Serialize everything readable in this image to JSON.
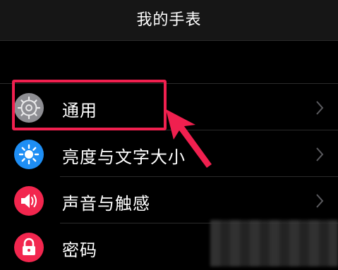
{
  "navbar": {
    "title": "我的手表"
  },
  "settings": [
    {
      "label": "通用",
      "icon": "gear-icon",
      "icon_color": "#8e8e93",
      "has_chevron": true
    },
    {
      "label": "亮度与文字大小",
      "icon": "brightness-icon",
      "icon_color": "#1e8ef4",
      "has_chevron": true
    },
    {
      "label": "声音与触感",
      "icon": "speaker-icon",
      "icon_color": "#f2264e",
      "has_chevron": true
    },
    {
      "label": "密码",
      "icon": "lock-icon",
      "icon_color": "#f2264e",
      "has_chevron": false
    }
  ],
  "annotation": {
    "color": "#f0204f"
  }
}
